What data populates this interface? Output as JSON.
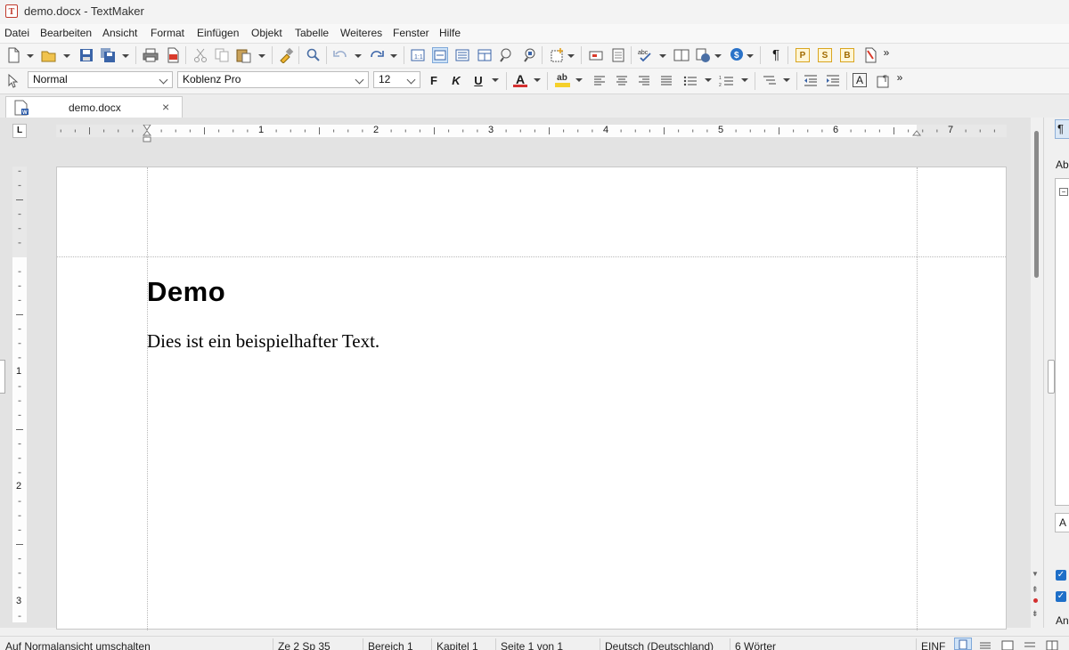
{
  "window": {
    "title": "demo.docx - TextMaker",
    "app_icon_letter": "T"
  },
  "menu": [
    "Datei",
    "Bearbeiten",
    "Ansicht",
    "Format",
    "Einfügen",
    "Objekt",
    "Tabelle",
    "Weiteres",
    "Fenster",
    "Hilfe"
  ],
  "formatbar": {
    "style": "Normal",
    "font": "Koblenz Pro",
    "size": "12",
    "bold_label": "F",
    "italic_label": "K",
    "underline_label": "U",
    "font_color_label": "A",
    "highlight_label": "ab",
    "more": "»"
  },
  "toolbar": {
    "more": "»",
    "pilcrow": "¶",
    "p_label": "P",
    "s_label": "S",
    "b_label": "B"
  },
  "tab": {
    "label": "demo.docx",
    "close": "×"
  },
  "ruler": {
    "tab_type": "L",
    "h_numbers": [
      "1",
      "2",
      "3",
      "4",
      "5",
      "6",
      "7"
    ],
    "v_numbers": [
      "1",
      "2",
      "3"
    ]
  },
  "document": {
    "heading": "Demo",
    "body": "Dies ist ein beispielhafter Text."
  },
  "sidepanel": {
    "header_fragment": "Ab",
    "field_fragment": "A",
    "bottom_fragment": "An"
  },
  "statusbar": {
    "hint": "Auf Normalansicht umschalten",
    "position": "Ze 2 Sp 35",
    "section": "Bereich 1",
    "chapter": "Kapitel 1",
    "page": "Seite 1 von 1",
    "language": "Deutsch (Deutschland)",
    "words": "6 Wörter",
    "mode": "EINF"
  },
  "colors": {
    "accent_red": "#c0392b",
    "font_color_bar": "#d32f2f",
    "highlight_bar": "#f5d02a",
    "checkbox_blue": "#1e6fc8"
  }
}
